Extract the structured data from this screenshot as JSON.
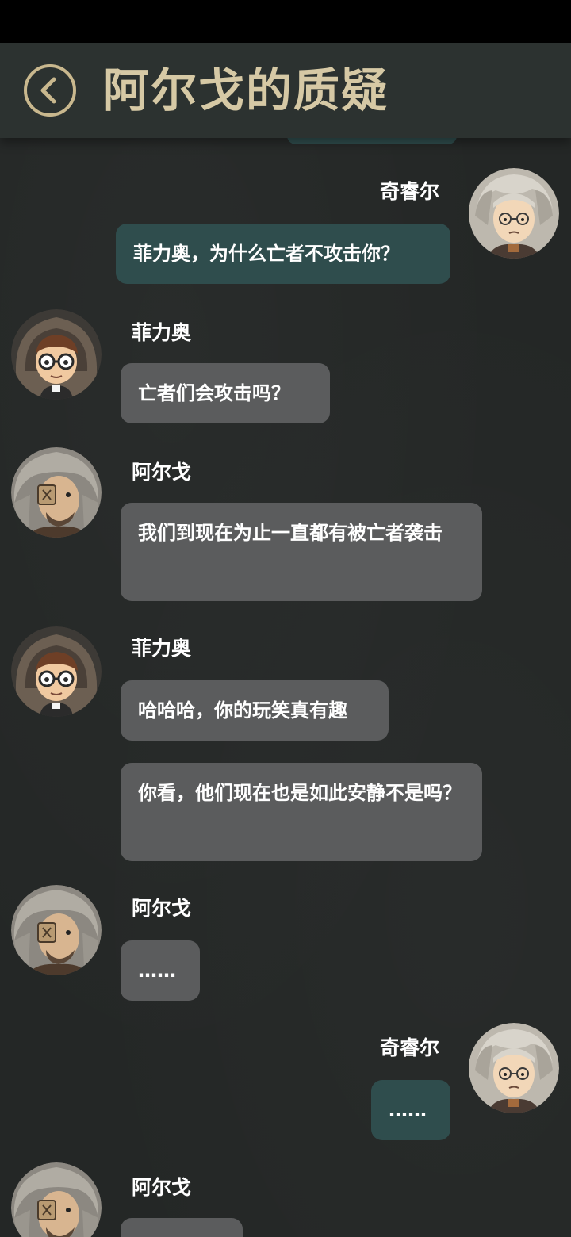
{
  "header": {
    "title": "阿尔戈的质疑",
    "back_icon": "chevron-left-icon"
  },
  "colors": {
    "title_gold": "#d6c9a5",
    "header_bg": "#2c3230",
    "chat_bg": "#242726",
    "bubble_left": "#5b5c5d",
    "bubble_right": "#2f4d4d"
  },
  "messages": [
    {
      "side": "right",
      "sender": "奇睿尔",
      "text": "菲力奥，为什么亡者不攻击你？"
    },
    {
      "side": "left",
      "sender": "菲力奥",
      "text": "亡者们会攻击吗？"
    },
    {
      "side": "left",
      "sender": "阿尔戈",
      "text": "我们到现在为止一直都有被亡者袭击"
    },
    {
      "side": "left",
      "sender": "菲力奥",
      "text": "哈哈哈，你的玩笑真有趣"
    },
    {
      "side": "left",
      "sender": "",
      "text": "你看，他们现在也是如此安静不是吗？"
    },
    {
      "side": "left",
      "sender": "阿尔戈",
      "text": "……"
    },
    {
      "side": "right",
      "sender": "奇睿尔",
      "text": "……"
    },
    {
      "side": "left",
      "sender": "阿尔戈",
      "text": ""
    }
  ]
}
